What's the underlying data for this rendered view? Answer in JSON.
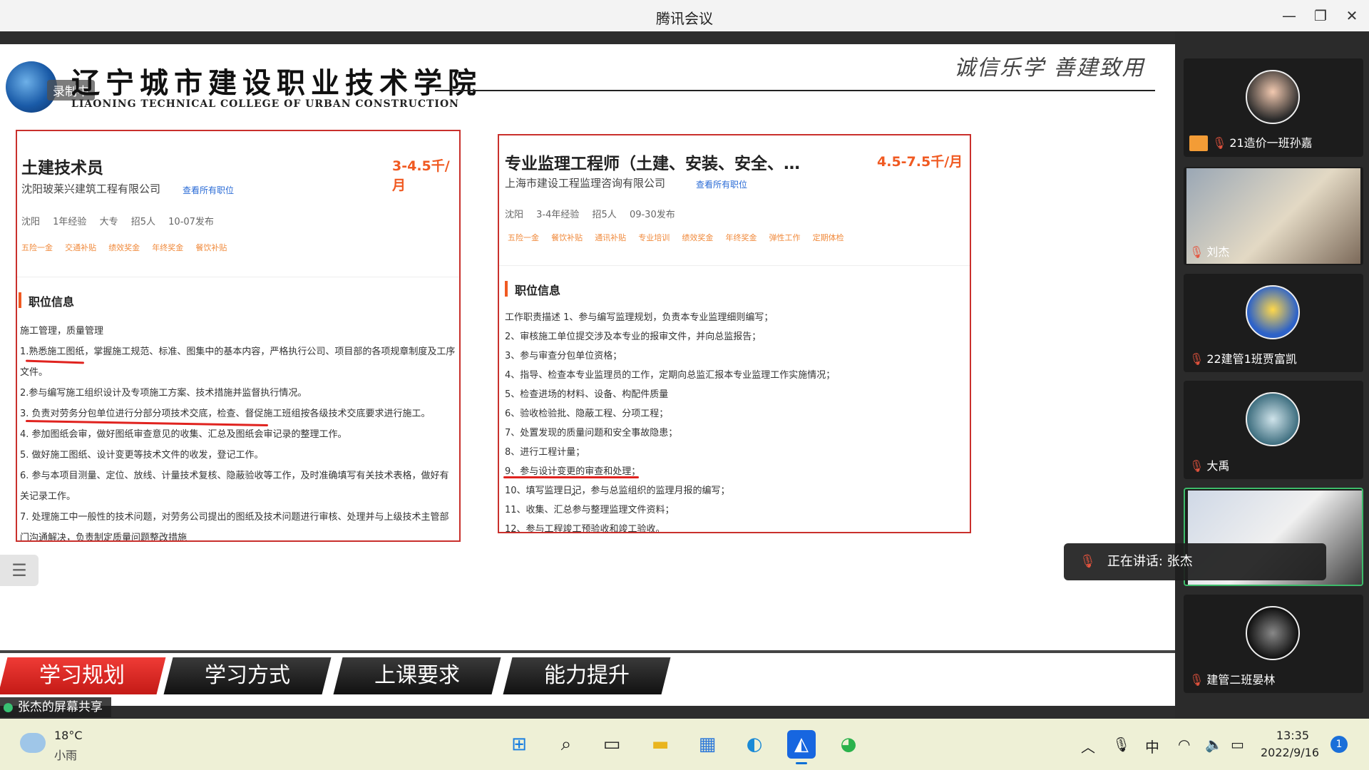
{
  "window": {
    "title": "腾讯会议",
    "minimize": "—",
    "restore": "❐",
    "close": "✕"
  },
  "slide": {
    "recording_label": "录制中",
    "school_cn": "辽宁城市建设职业技术学院",
    "school_en": "LIAONING TECHNICAL COLLEGE OF URBAN CONSTRUCTION",
    "motto": "诚信乐学  善建致用",
    "cards": [
      {
        "title": "土建技术员",
        "salary": "3-4.5千/月",
        "company": "沈阳玻莱兴建筑工程有限公司",
        "view_all": "查看所有职位",
        "meta": [
          "沈阳",
          "1年经验",
          "大专",
          "招5人",
          "10-07发布"
        ],
        "tags": [
          "五险一金",
          "交通补贴",
          "绩效奖金",
          "年终奖金",
          "餐饮补贴"
        ],
        "section_title": "职位信息",
        "lines": [
          "施工管理，质量管理",
          "1.熟悉施工图纸，掌握施工规范、标准、图集中的基本内容，严格执行公司、项目部的各项规章制度及工序文件。",
          "2.参与编写施工组织设计及专项施工方案、技术措施并监督执行情况。",
          "3. 负责对劳务分包单位进行分部分项技术交底，检查、督促施工班组按各级技术交底要求进行施工。",
          "4. 参加图纸会审，做好图纸审查意见的收集、汇总及图纸会审记录的整理工作。",
          "5. 做好施工图纸、设计变更等技术文件的收发，登记工作。",
          "6. 参与本项目测量、定位、放线、计量技术复核、隐蔽验收等工作，及时准确填写有关技术表格，做好有关记录工作。",
          "7. 处理施工中一般性的技术问题，对劳务公司提出的图纸及技术问题进行审核、处理并与上级技术主管部门沟通解决，负责制定质量问题整改措施"
        ]
      },
      {
        "title": "专业监理工程师（土建、安装、安全、…",
        "salary": "4.5-7.5千/月",
        "company": "上海市建设工程监理咨询有限公司",
        "view_all": "查看所有职位",
        "meta": [
          "沈阳",
          "3-4年经验",
          "招5人",
          "09-30发布"
        ],
        "tags": [
          "五险一金",
          "餐饮补贴",
          "通讯补贴",
          "专业培训",
          "绩效奖金",
          "年终奖金",
          "弹性工作",
          "定期体检"
        ],
        "section_title": "职位信息",
        "lines": [
          "工作职责描述 1、参与编写监理规划，负责本专业监理细则编写；",
          "2、审核施工单位提交涉及本专业的报审文件，并向总监报告；",
          "3、参与审查分包单位资格；",
          "4、指导、检查本专业监理员的工作，定期向总监汇报本专业监理工作实施情况；",
          "5、检查进场的材料、设备、构配件质量",
          "6、验收检验批、隐蔽工程、分项工程；",
          "7、处置发现的质量问题和安全事故隐患；",
          "8、进行工程计量；",
          "9、参与设计变更的审查和处理；",
          "10、填写监理日记，参与总监组织的监理月报的编写；",
          "11、收集、汇总参与整理监理文件资料；",
          "12、参与工程竣工预验收和竣工验收。"
        ]
      }
    ],
    "footer_tabs": [
      "学习规划",
      "学习方式",
      "上课要求",
      "能力提升"
    ],
    "menu_icon": "☰"
  },
  "share_status": "张杰的屏幕共享",
  "participants": [
    {
      "name": "21造价一班孙嘉",
      "host": true
    },
    {
      "name": "刘杰",
      "host": false
    },
    {
      "name": "22建管1班贾富凯",
      "host": false
    },
    {
      "name": "大禹",
      "host": false
    },
    {
      "name": "",
      "host": false
    },
    {
      "name": "建管二班晏林",
      "host": false
    }
  ],
  "speaking": "正在讲话: 张杰",
  "taskbar": {
    "weather_temp": "18°C",
    "weather_desc": "小雨",
    "time": "13:35",
    "date": "2022/9/16",
    "ime": "中",
    "notifications": "1"
  },
  "colors": {
    "accent_red": "#c9302c",
    "salary_orange": "#f05a22",
    "speaking_green": "#3dbb6a"
  }
}
